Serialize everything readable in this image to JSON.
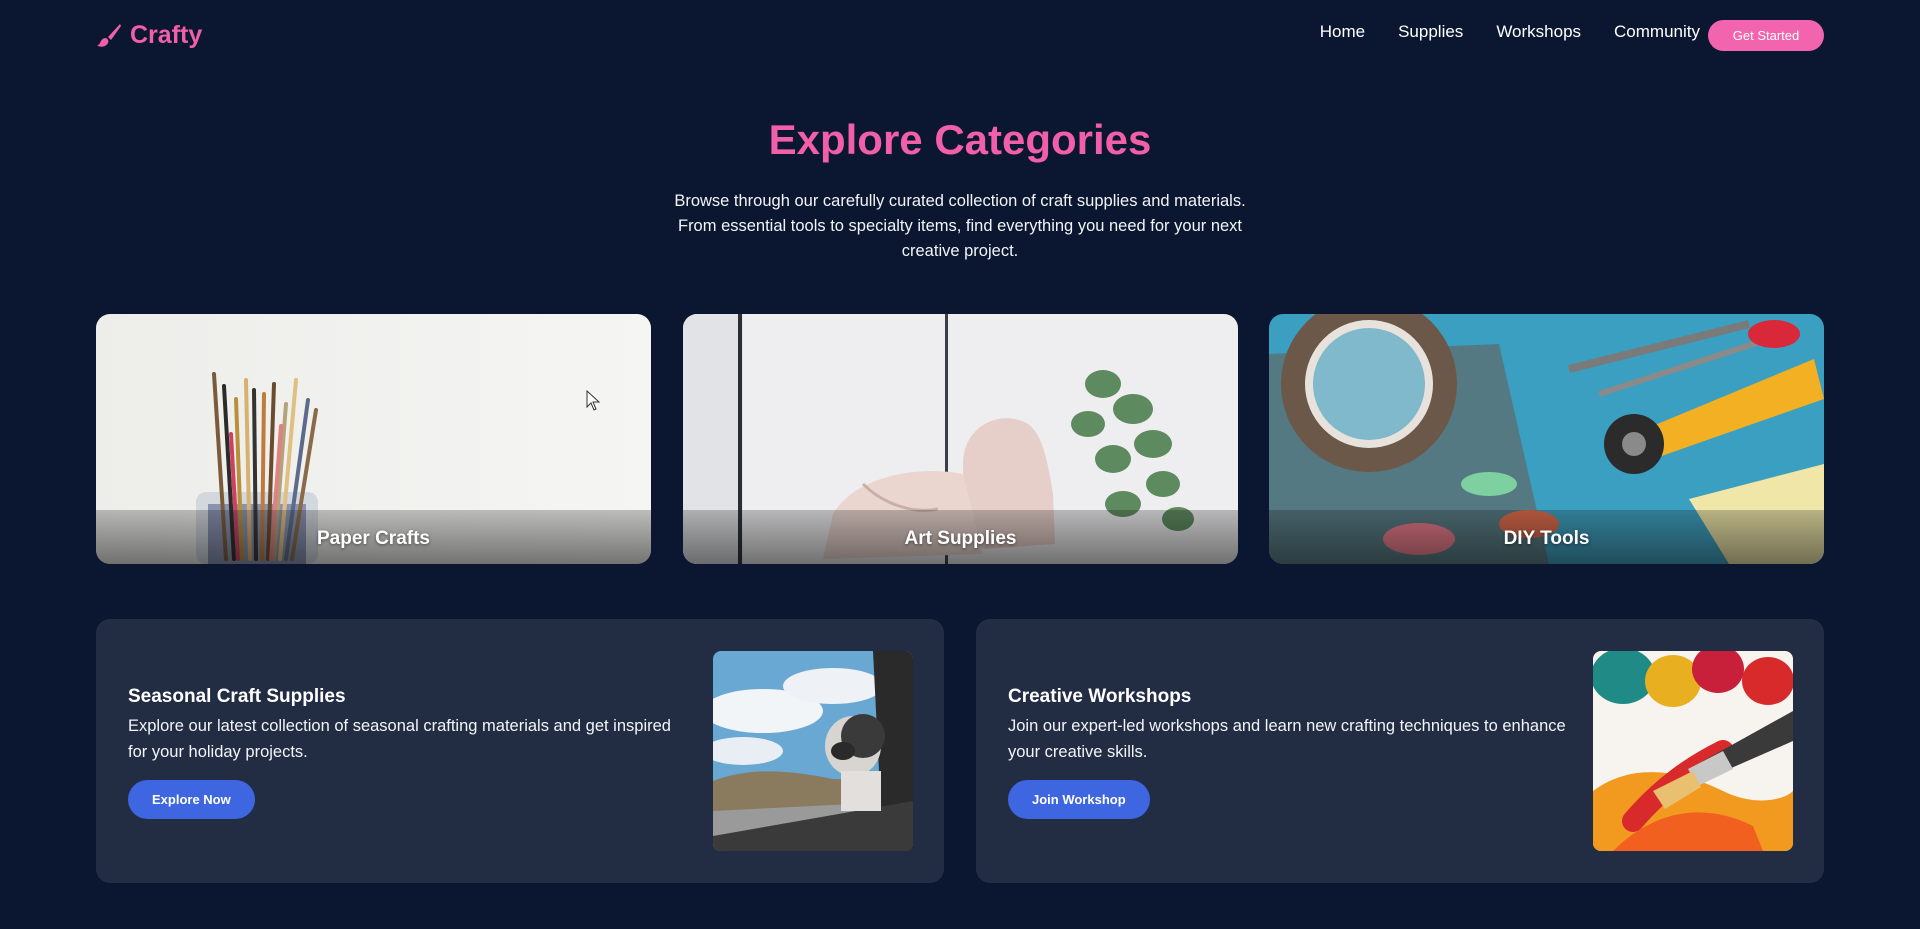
{
  "brand": {
    "name": "Crafty",
    "icon": "paintbrush-icon",
    "color": "#f05fa8"
  },
  "nav": {
    "links": [
      "Home",
      "Supplies",
      "Workshops",
      "Community"
    ],
    "cta_label": "Get Started"
  },
  "hero": {
    "title": "Explore Categories",
    "subtitle": "Browse through our carefully curated collection of craft supplies and materials. From essential tools to specialty items, find everything you need for your next creative project."
  },
  "categories": [
    {
      "label": "Paper Crafts",
      "image": "brushes-in-jar"
    },
    {
      "label": "Art Supplies",
      "image": "shoes-and-eucalyptus"
    },
    {
      "label": "DIY Tools",
      "image": "tape-scissors-cutter"
    }
  ],
  "promos": [
    {
      "title": "Seasonal Craft Supplies",
      "text": "Explore our latest collection of seasonal crafting materials and get inspired for your holiday projects.",
      "button": "Explore Now",
      "image": "dog-in-car-window"
    },
    {
      "title": "Creative Workshops",
      "text": "Join our expert-led workshops and learn new crafting techniques to enhance your creative skills.",
      "button": "Join Workshop",
      "image": "paint-brush-red-orange"
    }
  ],
  "colors": {
    "background": "#0b1730",
    "accent_pink": "#f264ad",
    "panel": "#222d44",
    "button_blue": "#3e66e0"
  }
}
